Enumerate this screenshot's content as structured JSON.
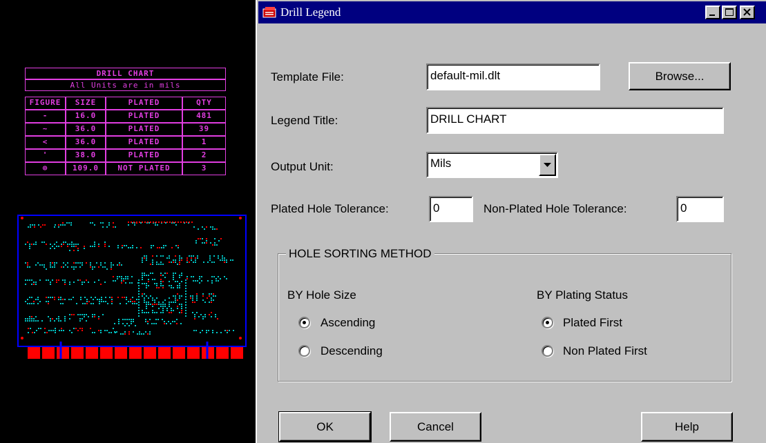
{
  "drill_chart": {
    "title": "DRILL CHART",
    "subtitle": "All Units are in mils",
    "headers": [
      "FIGURE",
      "SIZE",
      "PLATED",
      "QTY"
    ],
    "rows": [
      {
        "figure": "-",
        "size": "16.0",
        "plated": "PLATED",
        "qty": "481"
      },
      {
        "figure": "~",
        "size": "36.0",
        "plated": "PLATED",
        "qty": "39"
      },
      {
        "figure": "<",
        "size": "36.0",
        "plated": "PLATED",
        "qty": "1"
      },
      {
        "figure": "'",
        "size": "38.0",
        "plated": "PLATED",
        "qty": "2"
      },
      {
        "figure": "⊚",
        "size": "109.0",
        "plated": "NOT PLATED",
        "qty": "3"
      }
    ]
  },
  "dialog": {
    "title": "Drill Legend",
    "title_buttons": {
      "minimize": "▁",
      "maximize": "□",
      "close": "✕"
    },
    "template_file_label": "Template File:",
    "template_file_value": "default-mil.dlt",
    "browse_label": "Browse...",
    "legend_title_label": "Legend Title:",
    "legend_title_value": "DRILL CHART",
    "output_unit_label": "Output Unit:",
    "output_unit_value": "Mils",
    "plated_tol_label": "Plated Hole Tolerance:",
    "plated_tol_value": "0",
    "nonplated_tol_label": "Non-Plated Hole Tolerance:",
    "nonplated_tol_value": "0",
    "sorting_group_label": "HOLE SORTING METHOD",
    "by_size_label": "BY Hole Size",
    "ascending_label": "Ascending",
    "descending_label": "Descending",
    "by_plating_label": "BY Plating Status",
    "plated_first_label": "Plated First",
    "non_plated_first_label": "Non Plated First",
    "hole_size_order": "Ascending",
    "plating_order": "Plated First",
    "ok_label": "OK",
    "cancel_label": "Cancel",
    "help_label": "Help"
  },
  "colors": {
    "title_bar": "#000080",
    "dialog_face": "#c0c0c0",
    "chart_magenta": "#e23ee2",
    "board_outline": "#0000ff",
    "pad_cyan": "#00c8c8",
    "pad_red": "#ff0000"
  }
}
